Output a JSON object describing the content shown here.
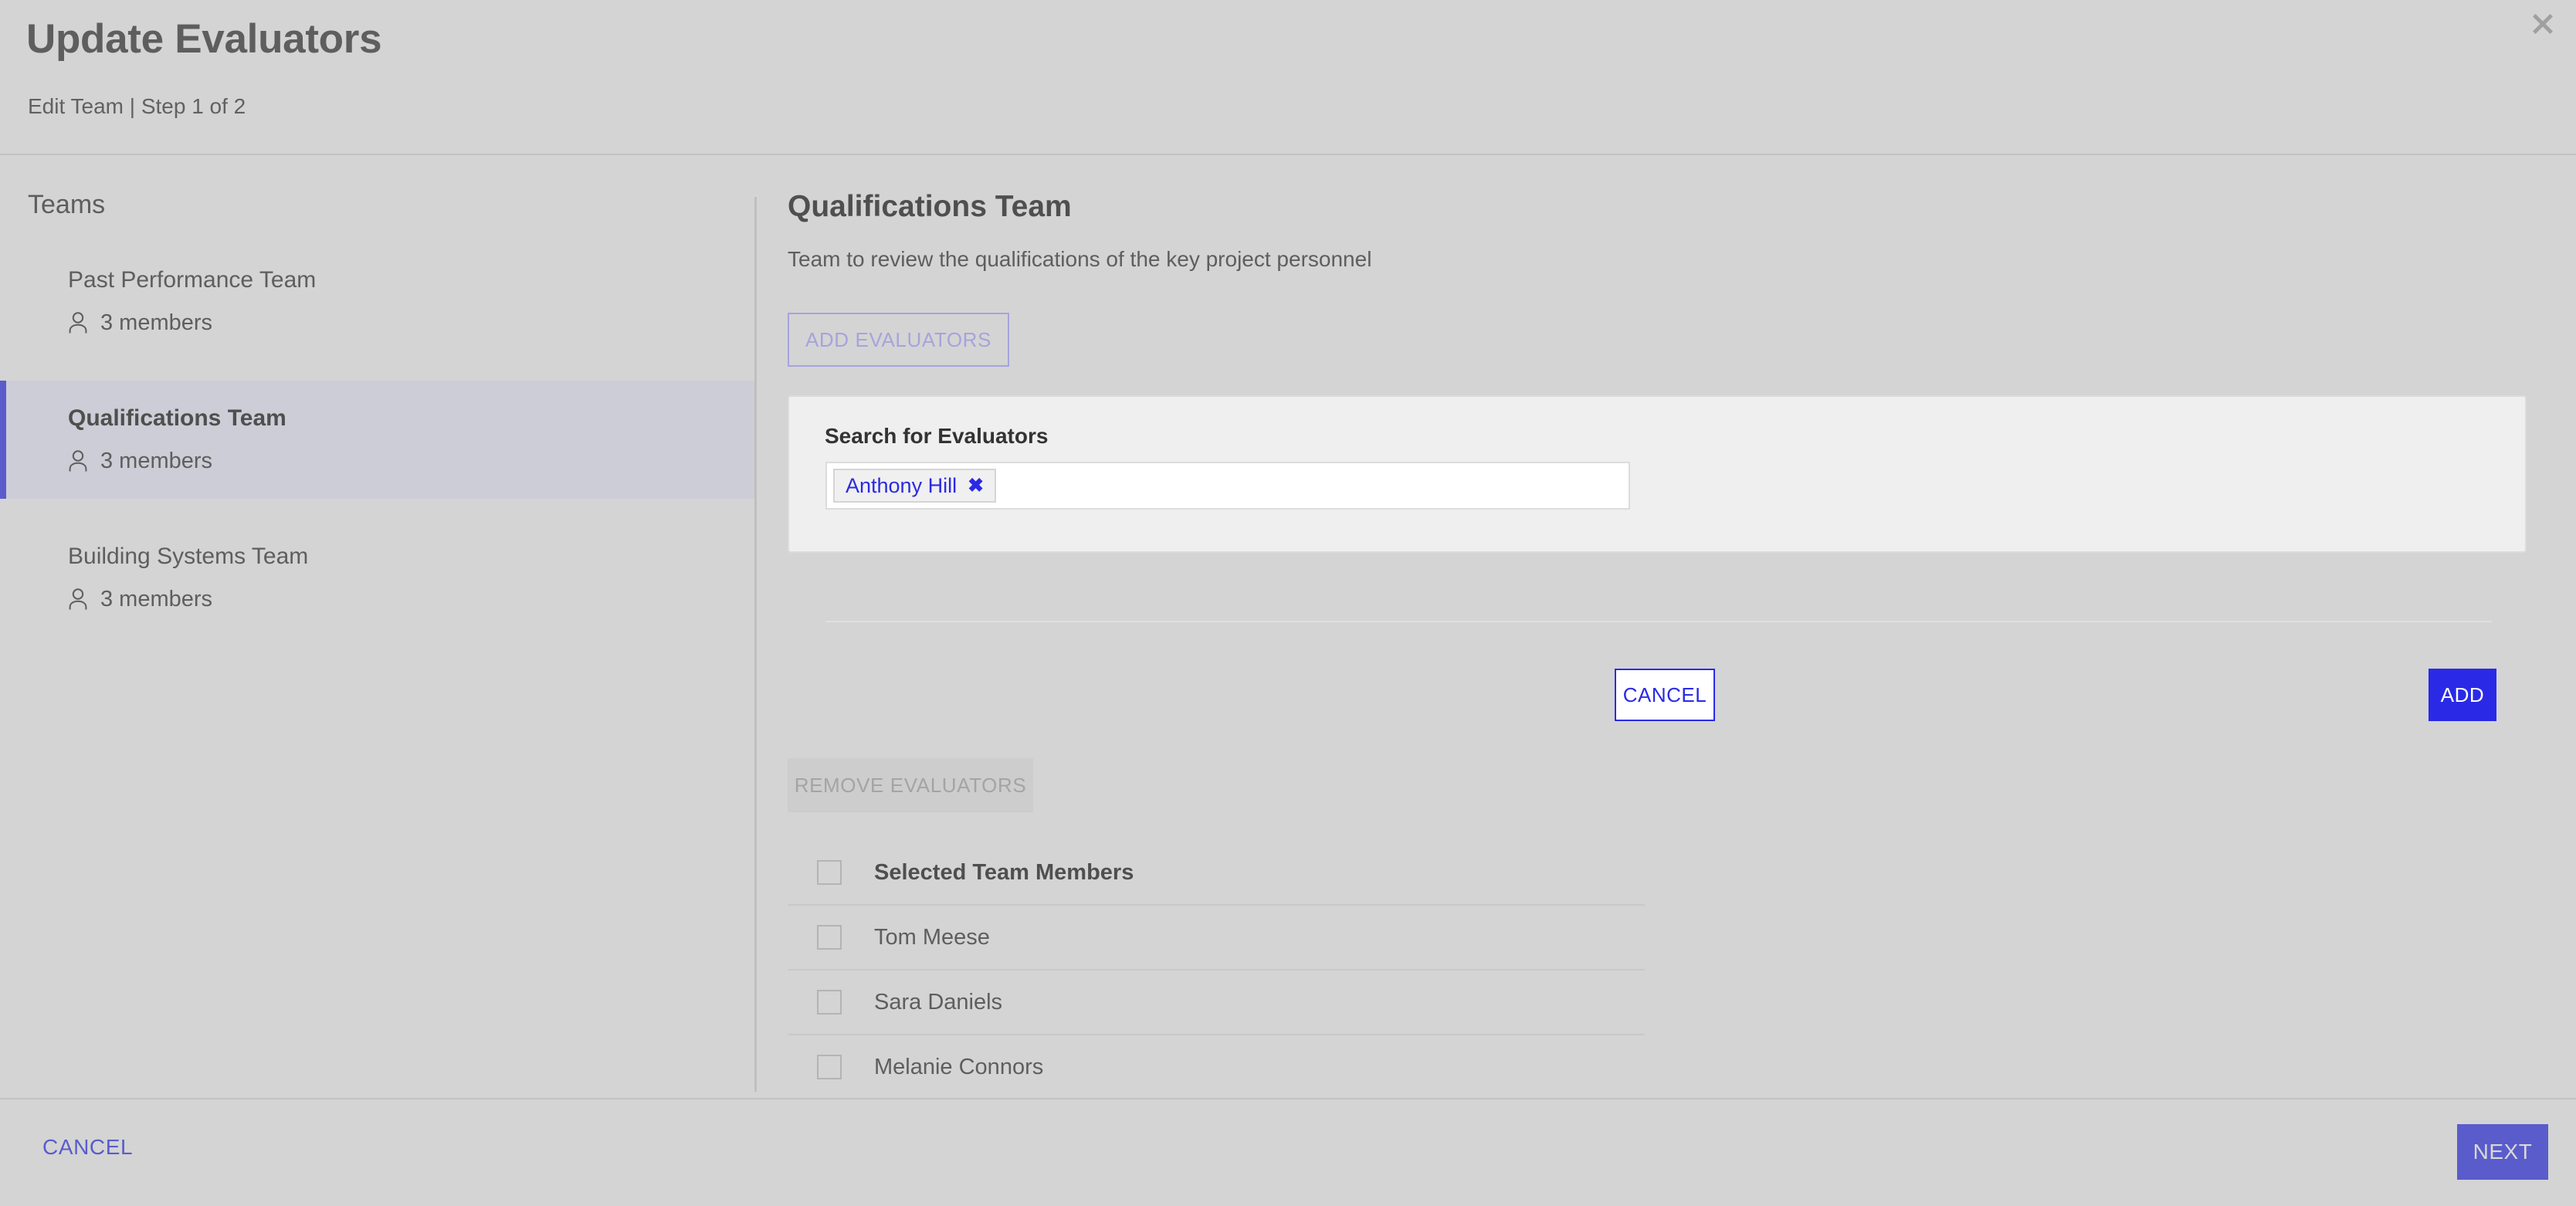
{
  "header": {
    "title": "Update Evaluators",
    "breadcrumb": "Edit Team | Step 1 of 2",
    "close_icon": "close-icon"
  },
  "sidebar": {
    "title": "Teams",
    "items": [
      {
        "name": "Past Performance Team",
        "members": "3 members",
        "selected": false
      },
      {
        "name": "Qualifications Team",
        "members": "3 members",
        "selected": true
      },
      {
        "name": "Building Systems Team",
        "members": "3 members",
        "selected": false
      }
    ]
  },
  "main": {
    "team_heading": "Qualifications Team",
    "team_description": "Team to review the qualifications of the key project personnel",
    "add_evaluators_label": "ADD EVALUATORS",
    "search_panel": {
      "label": "Search for Evaluators",
      "input_placeholder": "",
      "chips": [
        {
          "label": "Anthony Hill",
          "remove_icon": "✖"
        }
      ],
      "cancel_label": "CANCEL",
      "add_label": "ADD"
    },
    "remove_evaluators_label": "REMOVE EVALUATORS",
    "members_header": "Selected Team Members",
    "members": [
      {
        "name": "Tom Meese",
        "checked": false
      },
      {
        "name": "Sara Daniels",
        "checked": false
      },
      {
        "name": "Melanie Connors",
        "checked": false
      }
    ]
  },
  "footer": {
    "cancel_label": "CANCEL",
    "next_label": "NEXT"
  },
  "colors": {
    "accent_purple": "#5a5ccc",
    "accent_blue": "#2a2ae6",
    "page_bg": "#d4d4d4",
    "panel_bg": "#efefef",
    "muted_purple": "#a6a3dd"
  }
}
